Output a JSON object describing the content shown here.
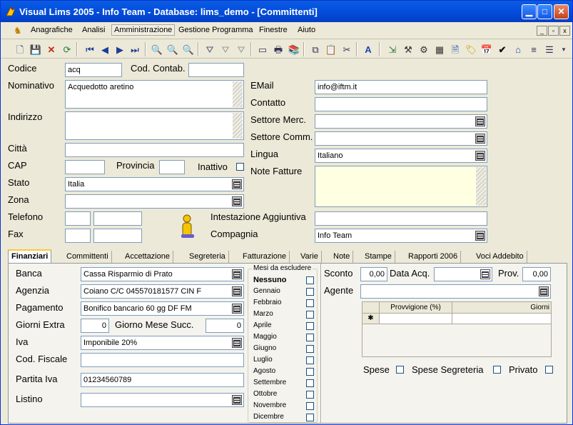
{
  "window": {
    "title": "Visual Lims 2005 - Info Team - Database: lims_demo - [Committenti]"
  },
  "menu": {
    "items": [
      "Anagrafiche",
      "Analisi",
      "Amministrazione",
      "Gestione Programma",
      "Finestre",
      "Aiuto"
    ]
  },
  "form": {
    "codice_label": "Codice",
    "codice": "acq",
    "cod_contab_label": "Cod. Contab.",
    "cod_contab": "",
    "nominativo_label": "Nominativo",
    "nominativo": "Acquedotto aretino",
    "indirizzo_label": "Indirizzo",
    "indirizzo": "",
    "citta_label": "Città",
    "citta": "",
    "cap_label": "CAP",
    "cap": "",
    "provincia_label": "Provincia",
    "provincia": "",
    "inattivo_label": "Inattivo",
    "stato_label": "Stato",
    "stato": "Italia",
    "zona_label": "Zona",
    "zona": "",
    "telefono_label": "Telefono",
    "fax_label": "Fax",
    "email_label": "EMail",
    "email": "info@iftm.it",
    "contatto_label": "Contatto",
    "contatto": "",
    "settore_merc_label": "Settore Merc.",
    "settore_merc": "",
    "settore_comm_label": "Settore Comm.",
    "settore_comm": "",
    "lingua_label": "Lingua",
    "lingua": "Italiano",
    "note_fatture_label": "Note Fatture",
    "note_fatture": "",
    "intestazione_label": "Intestazione Aggiuntiva",
    "intestazione": "",
    "compagnia_label": "Compagnia",
    "compagnia": "Info Team"
  },
  "tabs": [
    "Finanziari",
    "Committenti",
    "Accettazione",
    "Segreteria",
    "Fatturazione",
    "Varie",
    "Note",
    "Stampe",
    "Rapporti 2006",
    "Voci Addebito"
  ],
  "fin": {
    "banca_label": "Banca",
    "banca": "Cassa Risparmio di Prato",
    "agenzia_label": "Agenzia",
    "agenzia": "Coiano C/C 045570181577  CIN F",
    "pagamento_label": "Pagamento",
    "pagamento": "Bonifico bancario 60 gg DF FM",
    "giorni_extra_label": "Giorni Extra",
    "giorni_extra": "0",
    "giorno_mese_label": "Giorno Mese Succ.",
    "giorno_mese": "0",
    "iva_label": "Iva",
    "iva": "Imponibile 20%",
    "cod_fiscale_label": "Cod. Fiscale",
    "cod_fiscale": "",
    "partita_iva_label": "Partita Iva",
    "partita_iva": "01234560789",
    "listino_label": "Listino",
    "listino": "",
    "mesi_title": "Mesi da escludere",
    "mesi": [
      "Nessuno",
      "Gennaio",
      "Febbraio",
      "Marzo",
      "Aprile",
      "Maggio",
      "Giugno",
      "Luglio",
      "Agosto",
      "Settembre",
      "Ottobre",
      "Novembre",
      "Dicembre"
    ],
    "sconto_label": "Sconto",
    "sconto": "0,00",
    "data_acq_label": "Data Acq.",
    "data_acq": "",
    "prov_label": "Prov.",
    "prov": "0,00",
    "agente_label": "Agente",
    "agente": "",
    "grid_headers": [
      "Provvigione (%)",
      "Giorni"
    ],
    "grid_star": "✱",
    "spese_label": "Spese",
    "spese_segreteria_label": "Spese Segreteria",
    "privato_label": "Privato"
  },
  "icons": [
    "app-icon",
    "minimize-icon",
    "maximize-icon",
    "close-icon",
    "new-icon",
    "save-icon",
    "delete-icon",
    "refresh-icon",
    "first-icon",
    "prev-icon",
    "next-icon",
    "last-icon",
    "find-icon",
    "filter-icon",
    "print-icon",
    "calendar-icon",
    "check-icon",
    "person-icon"
  ]
}
